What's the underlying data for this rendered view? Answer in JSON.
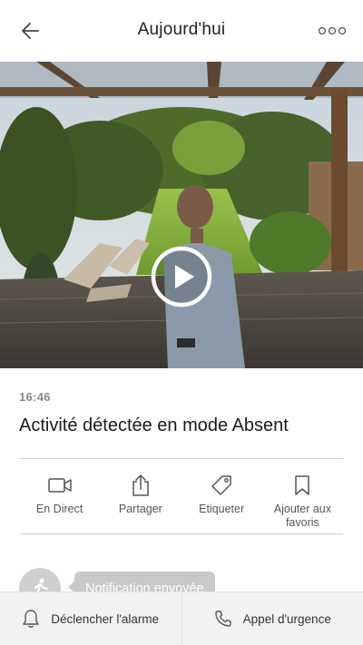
{
  "header": {
    "title": "Aujourd'hui",
    "back_icon": "arrow-left-icon",
    "more_icon": "more-dots-icon"
  },
  "event": {
    "time": "16:46",
    "title": "Activité détectée en mode Absent"
  },
  "actions": [
    {
      "label": "En Direct",
      "icon": "video-camera-icon"
    },
    {
      "label": "Partager",
      "icon": "share-icon"
    },
    {
      "label": "Etiqueter",
      "icon": "tag-icon"
    },
    {
      "label": "Ajouter aux favoris",
      "icon": "bookmark-icon"
    }
  ],
  "notification": {
    "text": "Notification envoyée",
    "icon": "running-person-icon"
  },
  "bottom_bar": {
    "alarm_label": "Déclencher l'alarme",
    "alarm_icon": "bell-icon",
    "emergency_label": "Appel d'urgence",
    "emergency_icon": "phone-icon"
  },
  "colors": {
    "accent": "#1a1a1a",
    "muted_text": "#8a8a8a",
    "bubble": "#c9c9c9"
  }
}
